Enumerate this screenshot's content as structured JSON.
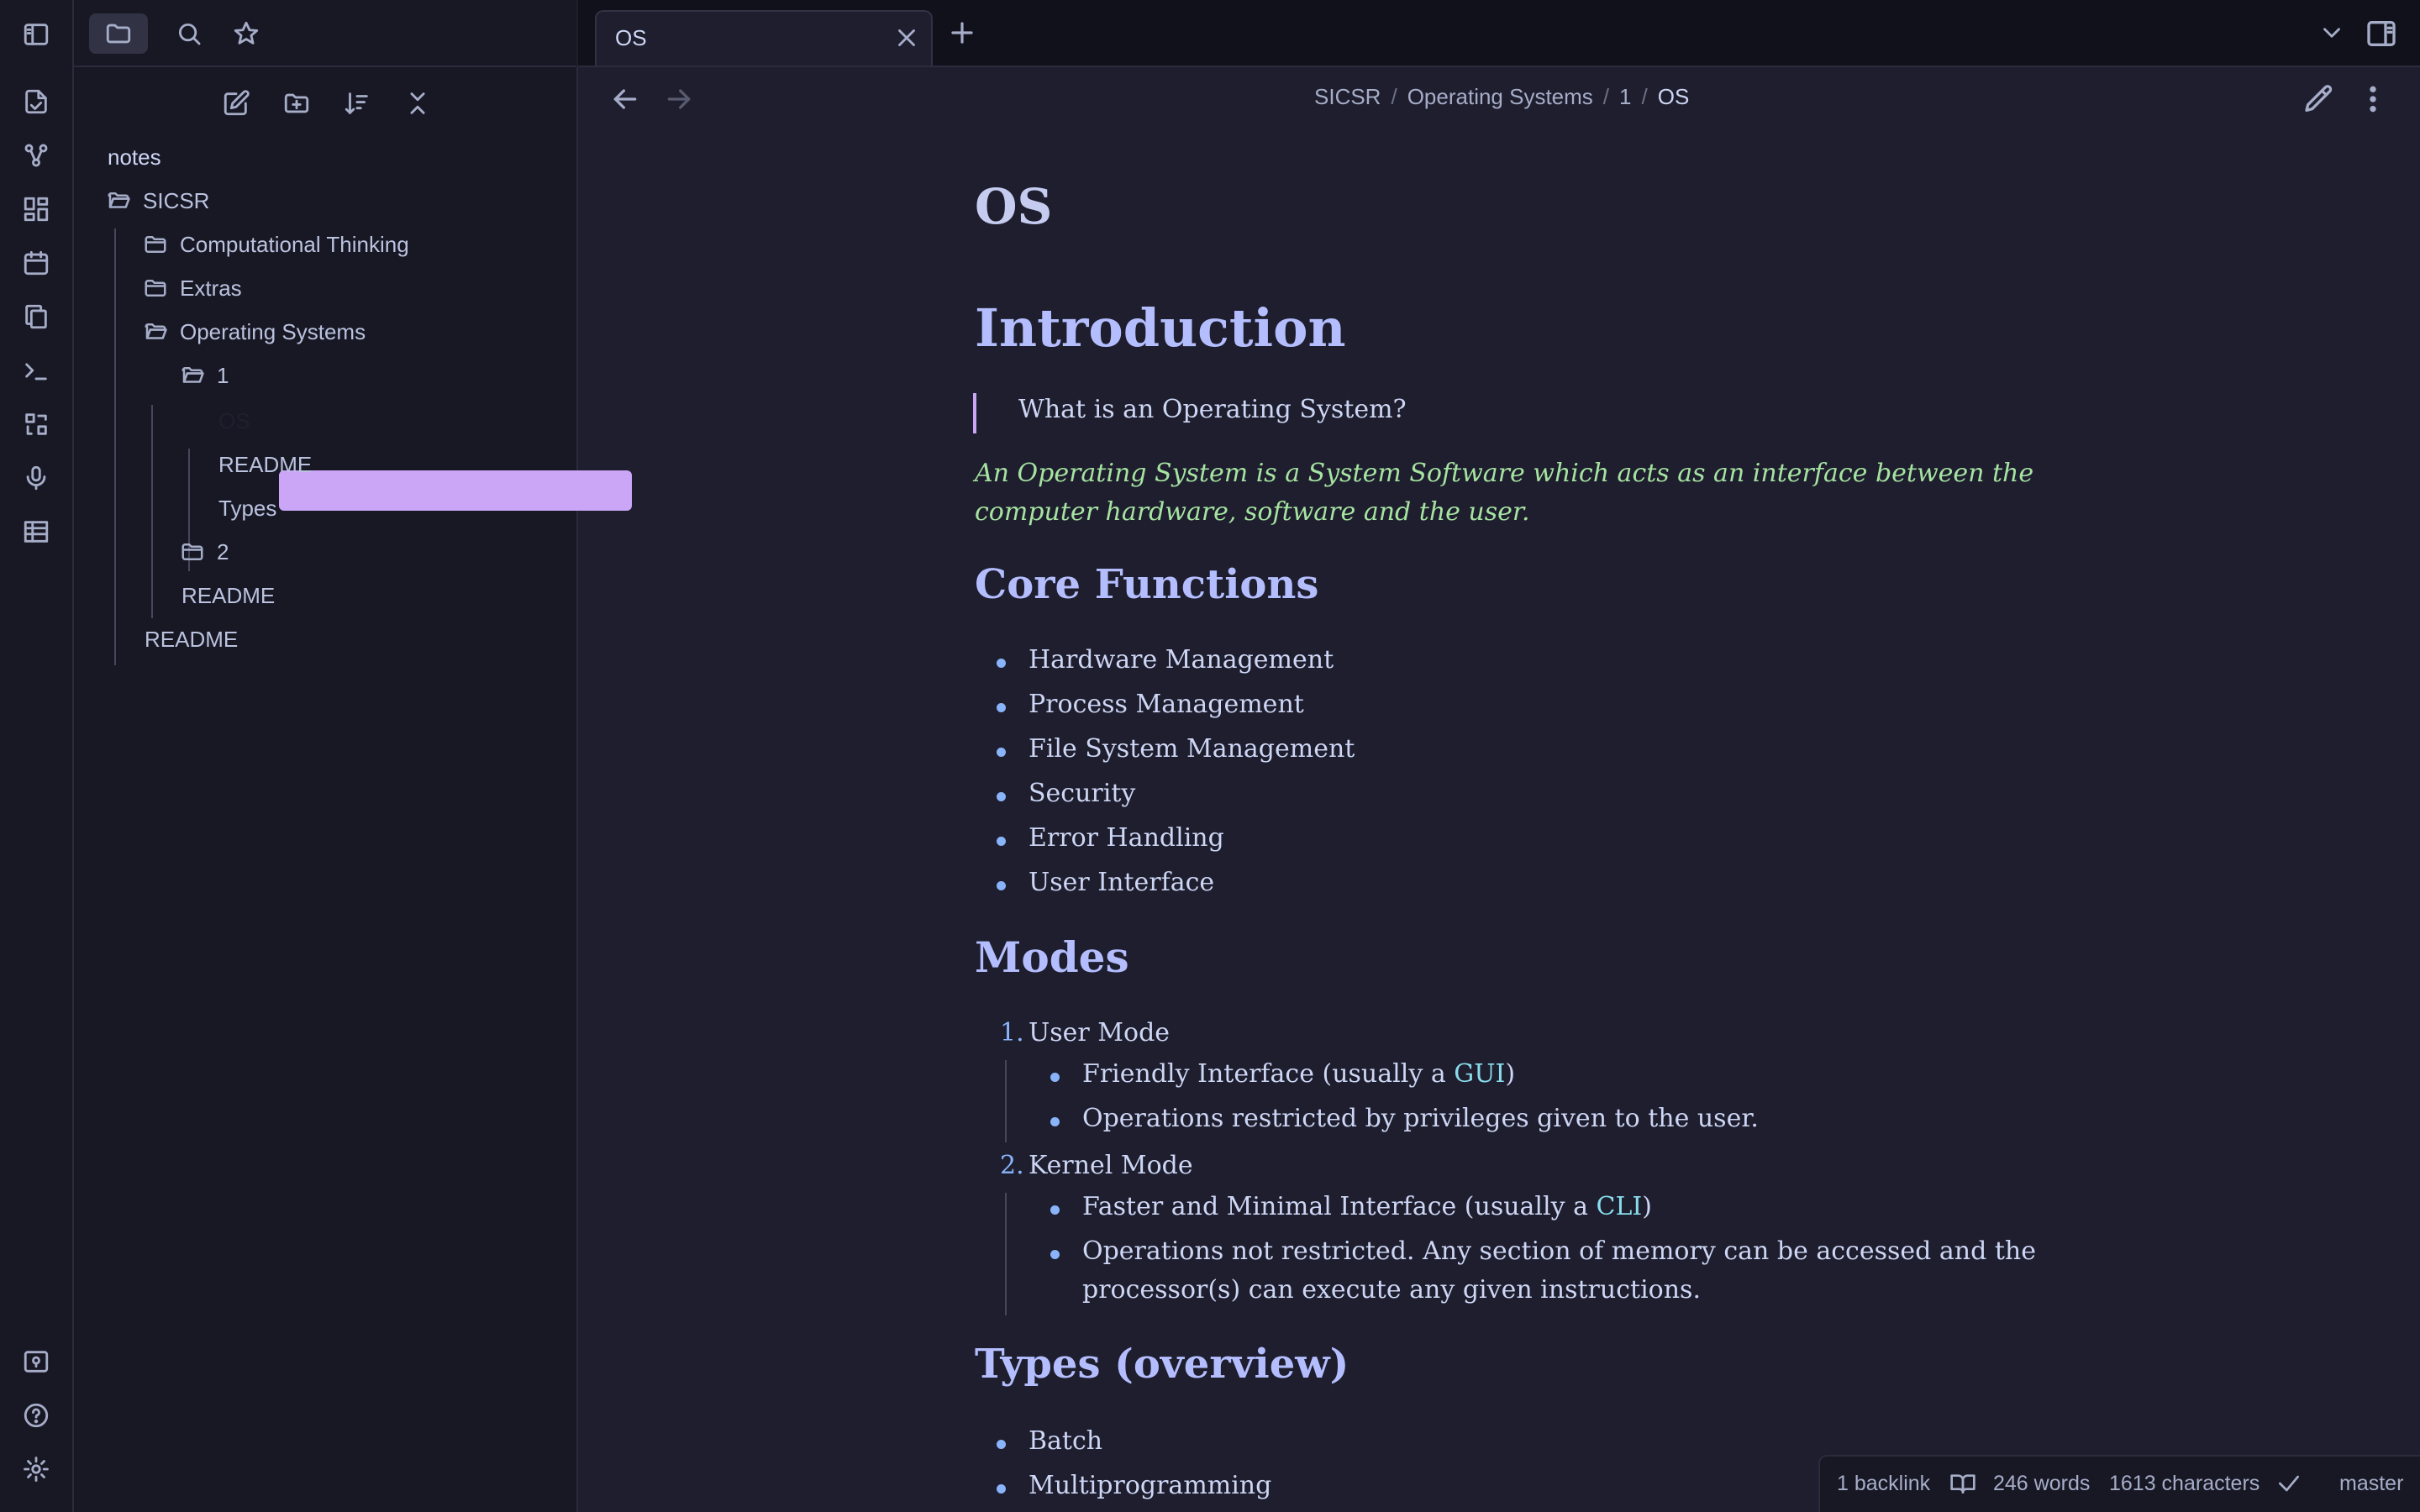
{
  "tabs": {
    "active_title": "OS"
  },
  "breadcrumb": {
    "items": [
      "SICSR",
      "Operating Systems",
      "1"
    ],
    "current": "OS"
  },
  "sidebar": {
    "vault_name": "notes",
    "tree": [
      {
        "label": "SICSR",
        "type": "folder"
      },
      {
        "label": "Computational Thinking",
        "type": "folder"
      },
      {
        "label": "Extras",
        "type": "folder"
      },
      {
        "label": "Operating Systems",
        "type": "folder"
      },
      {
        "label": "1",
        "type": "folder"
      },
      {
        "label": "OS",
        "type": "file",
        "active": true
      },
      {
        "label": "README",
        "type": "file"
      },
      {
        "label": "Types",
        "type": "file"
      },
      {
        "label": "2",
        "type": "folder"
      },
      {
        "label": "README",
        "type": "file"
      },
      {
        "label": "README",
        "type": "file"
      }
    ]
  },
  "document": {
    "title": "OS",
    "h_intro": "Introduction",
    "quote": "What is an Operating System?",
    "definition_line1": "An Operating System is a System Software which acts as an interface between the",
    "definition_line2": "computer hardware, software and the user.",
    "h_core": "Core Functions",
    "core_functions": [
      "Hardware Management",
      "Process Management",
      "File System Management",
      "Security",
      "Error Handling",
      "User Interface"
    ],
    "h_modes": "Modes",
    "mode1": {
      "num": "1.",
      "label": "User Mode",
      "sub1_prefix": "Friendly Interface (usually a ",
      "sub1_link": "GUI",
      "sub1_suffix": ")",
      "sub2": "Operations restricted by privileges given to the user."
    },
    "mode2": {
      "num": "2.",
      "label": "Kernel Mode",
      "sub1_prefix": "Faster and Minimal Interface (usually a ",
      "sub1_link": "CLI",
      "sub1_suffix": ")",
      "sub2_line1": "Operations not restricted. Any section of memory can be accessed and the",
      "sub2_line2": "processor(s) can execute any given instructions."
    },
    "h_types": "Types (overview)",
    "types": [
      "Batch",
      "Multiprogramming"
    ]
  },
  "status_bar": {
    "backlinks": "1 backlink",
    "words": "246 words",
    "characters": "1613 characters",
    "branch": "master"
  },
  "colors": {
    "accent": "#cba6f7",
    "heading": "#b4befe",
    "link": "#89dceb",
    "emphasis": "#a6e3a1",
    "background": "#1e1e2e"
  }
}
